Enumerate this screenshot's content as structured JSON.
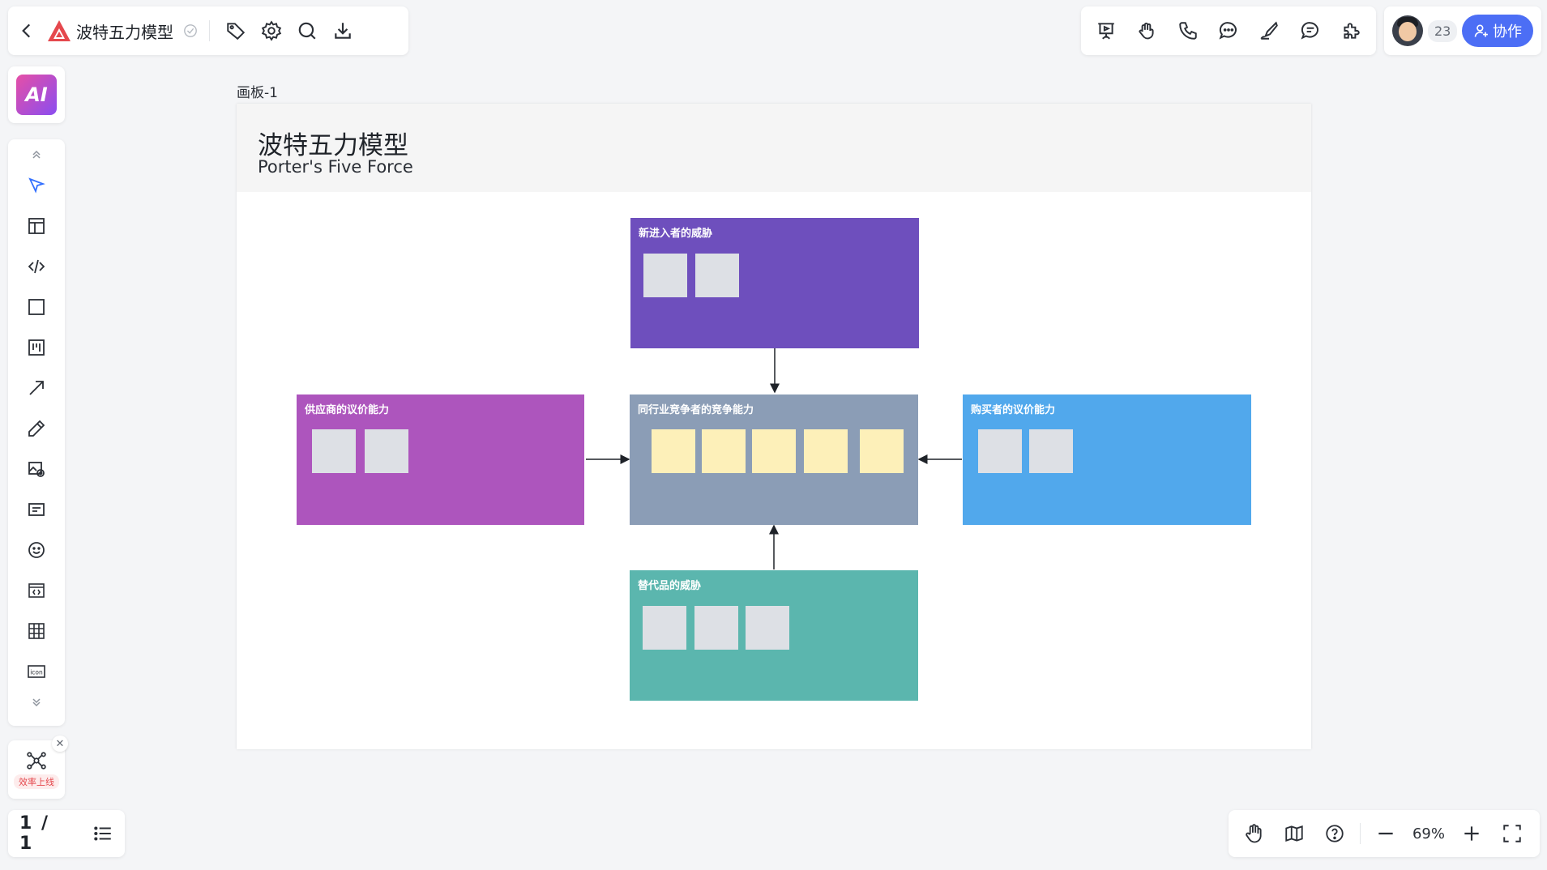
{
  "header": {
    "back_icon": "chevron-left-icon",
    "title": "波特五力模型",
    "logo_color": "#e5484d",
    "tools": [
      "tag-icon",
      "gear-icon",
      "search-icon",
      "download-icon"
    ]
  },
  "top_tools": [
    "present-icon",
    "hand-wave-icon",
    "phone-icon",
    "chat-icon",
    "sign-icon",
    "comments-icon",
    "plugin-icon"
  ],
  "collab": {
    "count": "23",
    "button_label": "协作",
    "button_color": "#4c6ef5"
  },
  "ai_button": {
    "label": "AI"
  },
  "left_tools": [
    "select-icon",
    "layout-icon",
    "code-icon",
    "rectangle-icon",
    "kanban-icon",
    "arrow-icon",
    "pen-icon",
    "image-icon",
    "text-box-icon",
    "emoji-icon",
    "code-block-icon",
    "table-icon",
    "icon-library-icon"
  ],
  "plugin": {
    "badge": "效率上线",
    "icon": "mind-map-icon"
  },
  "pages": {
    "current": "1 / 1"
  },
  "zoom": {
    "value": "69%"
  },
  "board": {
    "frame_label": "画板-1",
    "title": "波特五力模型",
    "subtitle": "Porter's Five Force",
    "forces": {
      "top": {
        "label": "新进入者的威胁",
        "color": "#6e4fbd"
      },
      "left": {
        "label": "供应商的议价能力",
        "color": "#ad55bd"
      },
      "center": {
        "label": "同行业竞争者的竞争能力",
        "color": "#8b9db6"
      },
      "right": {
        "label": "购买者的议价能力",
        "color": "#51a8ec"
      },
      "bottom": {
        "label": "替代品的威胁",
        "color": "#5bb6ae"
      }
    },
    "note_colors": {
      "gray": "#dde0e5",
      "yellow": "#fdf0b9"
    }
  }
}
